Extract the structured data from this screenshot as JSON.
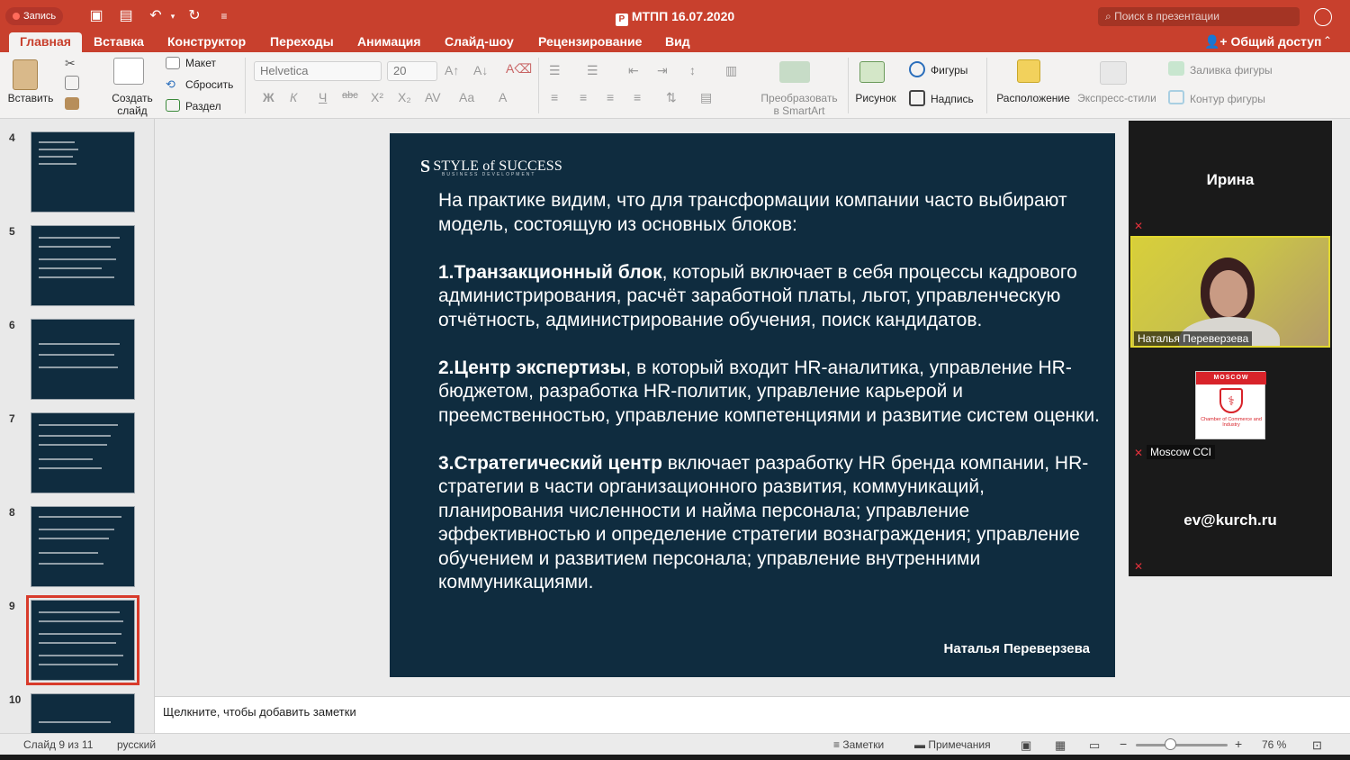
{
  "titlebar": {
    "recording": "Запись",
    "document_title": "МТПП 16.07.2020",
    "search_placeholder": "Поиск в презентации"
  },
  "tabs": [
    {
      "label": "Главная",
      "active": true
    },
    {
      "label": "Вставка"
    },
    {
      "label": "Конструктор"
    },
    {
      "label": "Переходы"
    },
    {
      "label": "Анимация"
    },
    {
      "label": "Слайд-шоу"
    },
    {
      "label": "Рецензирование"
    },
    {
      "label": "Вид"
    }
  ],
  "share_label": "Общий доступ",
  "ribbon": {
    "paste": "Вставить",
    "new_slide": "Создать\nслайд",
    "layout": "Макет",
    "reset": "Сбросить",
    "section": "Раздел",
    "font_name": "Helvetica",
    "font_size": "20",
    "convert_smartart": "Преобразовать\nв SmartArt",
    "picture": "Рисунок",
    "shapes": "Фигуры",
    "textbox": "Надпись",
    "arrange": "Расположение",
    "quick_styles": "Экспресс-стили",
    "shape_fill": "Заливка фигуры",
    "shape_outline": "Контур фигуры"
  },
  "thumbnails": [
    {
      "num": "4"
    },
    {
      "num": "5"
    },
    {
      "num": "6"
    },
    {
      "num": "7"
    },
    {
      "num": "8"
    },
    {
      "num": "9",
      "selected": true
    },
    {
      "num": "10"
    }
  ],
  "slide": {
    "logo": "STYLE of SUCCESS",
    "logo_sub": "BUSINESS DEVELOPMENT",
    "intro": "На практике видим, что для трансформации компании часто выбирают модель, состоящую из основных блоков:",
    "block1_title": "1.Транзакционный блок",
    "block1_text": ", который включает в себя процессы кадрового администрирования, расчёт заработной платы, льгот, управленческую отчётность, администрирование обучения, поиск кандидатов.",
    "block2_title": "2.Центр экспертизы",
    "block2_text": ", в который входит HR-аналитика, управление HR-бюджетом, разработка HR-политик, управление карьерой и преемственностью, управление компетенциями и развитие систем оценки.",
    "block3_title": "3.Стратегический центр",
    "block3_text": " включает разработку HR  бренда компании, HR-стратегии в части организационного развития, коммуникаций, планирования численности и найма персонала; управление эффективностью и определение стратегии вознаграждения; управление обучением и развитием персонала; управление внутренними коммуникациями.",
    "author": "Наталья Переверзева"
  },
  "video": {
    "tile1_name": "Ирина",
    "tile2_label": "Наталья Переверзева",
    "cci_bar": "MOSCOW",
    "cci_text": "Chamber of Commerce and Industry",
    "tile3_label": "Moscow CCI",
    "tile4_name": "ev@kurch.ru"
  },
  "notes_placeholder": "Щелкните, чтобы добавить заметки",
  "status": {
    "slide_counter": "Слайд 9 из 11",
    "language": "русский",
    "notes": "Заметки",
    "comments": "Примечания",
    "zoom": "76 %",
    "zoom_level": 0.38
  }
}
